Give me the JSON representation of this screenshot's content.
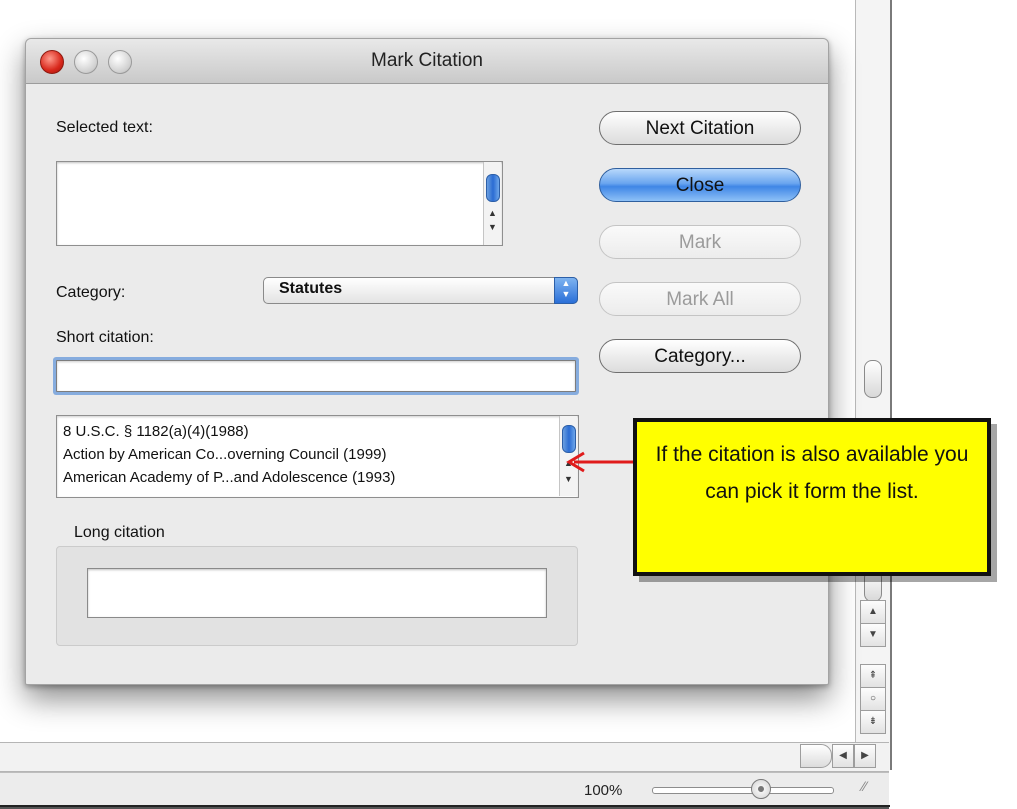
{
  "dialog": {
    "title": "Mark Citation",
    "selected_text_label": "Selected text:",
    "selected_text_value": "",
    "category_label": "Category:",
    "category_value": "Statutes",
    "short_citation_label": "Short citation:",
    "short_citation_value": "",
    "citation_list": [
      "8 U.S.C. § 1182(a)(4)(1988)",
      "Action by American Co...overning Council (1999)",
      "American Academy of P...and Adolescence (1993)"
    ],
    "long_citation_label": "Long citation",
    "long_citation_value": "",
    "buttons": {
      "next_citation": "Next Citation",
      "close": "Close",
      "mark": "Mark",
      "mark_all": "Mark All",
      "category": "Category..."
    }
  },
  "callout": {
    "text": "If the citation is also available you can pick it form the list."
  },
  "status_bar": {
    "zoom": "100%"
  },
  "colors": {
    "callout_bg": "#ffff00",
    "arrow": "#e01b1b",
    "primary_button": "#4a8de8"
  }
}
